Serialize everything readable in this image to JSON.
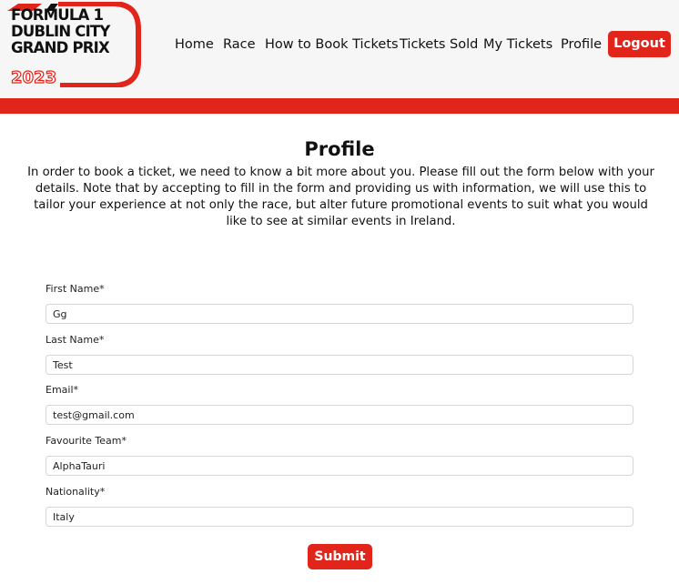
{
  "brand": {
    "line1": "FORMULA 1",
    "line2": "DUBLIN CITY",
    "line3": "GRAND PRIX",
    "year": "2023",
    "accent_color": "#e1251b"
  },
  "nav": {
    "items": [
      "Home",
      "Race",
      "How to Book Tickets",
      "Tickets Sold",
      "My Tickets",
      "Profile"
    ],
    "logout_label": "Logout"
  },
  "page": {
    "title": "Profile",
    "intro": "In order to book a ticket, we need to know a bit more about you. Please fill out the form below with your details. Note that by accepting to fill in the form and providing us with information, we will use this to tailor your experience at not only the race, but alter future promotional events to suit what you would like to see at similar events in Ireland."
  },
  "form": {
    "fields": [
      {
        "label": "First Name*",
        "value": "Gg"
      },
      {
        "label": "Last Name*",
        "value": "Test"
      },
      {
        "label": "Email*",
        "value": "test@gmail.com"
      },
      {
        "label": "Favourite Team*",
        "value": "AlphaTauri"
      },
      {
        "label": "Nationality*",
        "value": "Italy"
      }
    ],
    "submit_label": "Submit"
  }
}
